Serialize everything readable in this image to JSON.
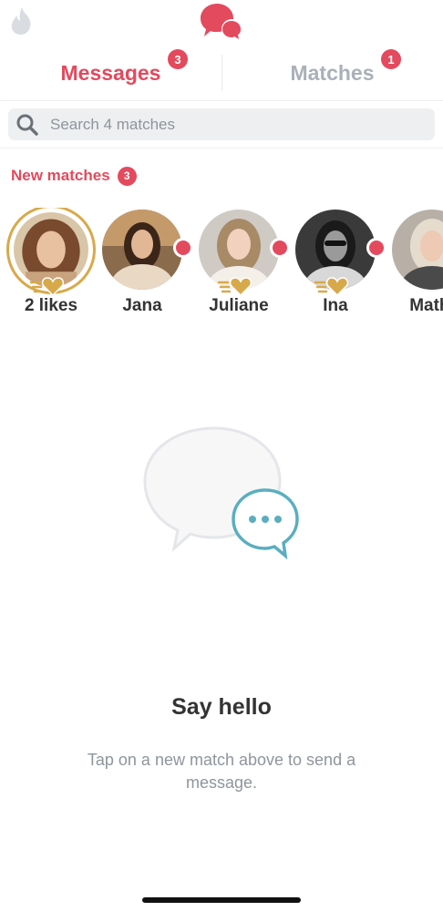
{
  "colors": {
    "accent": "#e34a5e",
    "inactive_tab": "#aab0b8",
    "gold": "#d8a94a",
    "chat_bubble_blue": "#5aaec0"
  },
  "header": {
    "left_icon": "flame-icon",
    "center_icon": "chat-bubbles-icon"
  },
  "tabs": [
    {
      "label": "Messages",
      "badge": "3",
      "active": true
    },
    {
      "label": "Matches",
      "badge": "1",
      "active": false
    }
  ],
  "search": {
    "placeholder": "Search 4 matches",
    "value": ""
  },
  "new_matches": {
    "title": "New matches",
    "count": "3",
    "items": [
      {
        "name": "2 likes",
        "type": "likes",
        "unread": false,
        "super_like": true
      },
      {
        "name": "Jana",
        "type": "match",
        "unread": true,
        "super_like": false
      },
      {
        "name": "Juliane",
        "type": "match",
        "unread": true,
        "super_like": true
      },
      {
        "name": "Ina",
        "type": "match",
        "unread": true,
        "super_like": true
      },
      {
        "name": "Mathi",
        "type": "match",
        "unread": false,
        "super_like": false
      }
    ]
  },
  "empty_state": {
    "icon": "chat-bubbles-illustration",
    "title": "Say hello",
    "subtitle": "Tap on a new match above to send a message."
  }
}
